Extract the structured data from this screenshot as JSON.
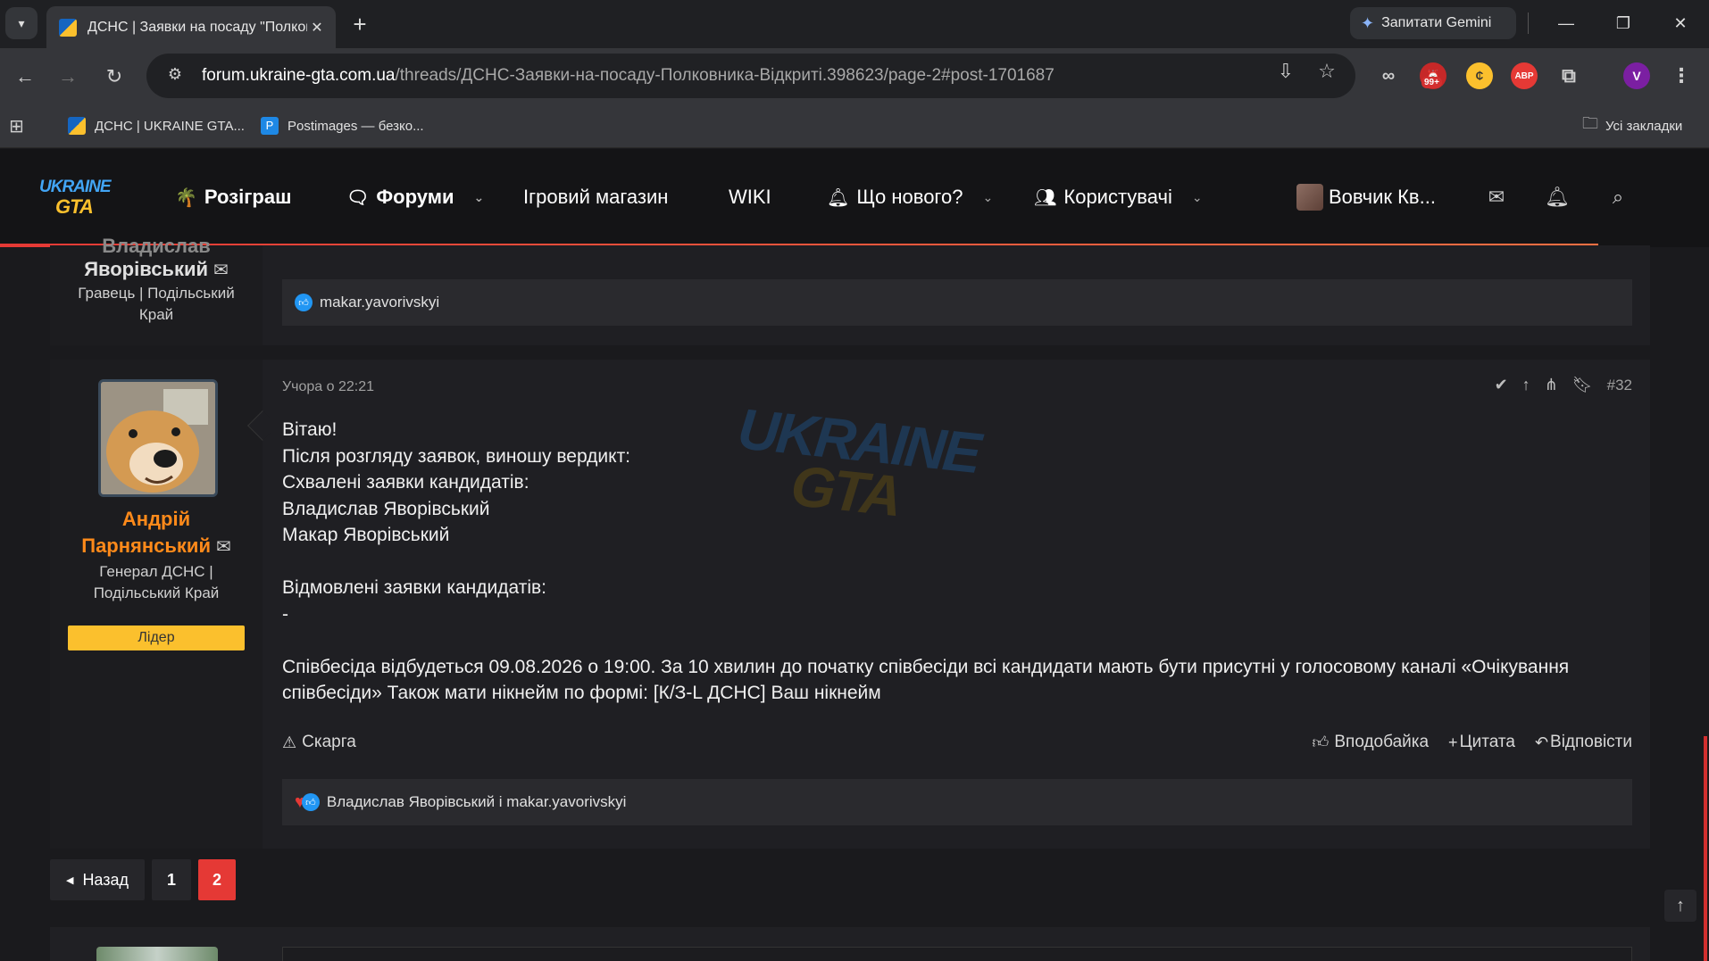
{
  "browser": {
    "tab": {
      "title": "ДСНС | Заявки на посаду \"Полковника\" Відкриті",
      "close_icon": "close-icon"
    },
    "gemini_label": "Запитати Gemini",
    "url_host": "forum.ukraine-gta.com.ua",
    "url_path": "/threads/ДСНС-Заявки-на-посаду-Полковника-Відкриті.398623/page-2#post-1701687",
    "extensions": {
      "badge_count": "99+",
      "abp_label": "ABP",
      "profile_initial": "V"
    },
    "bookmarks": [
      {
        "label": "ДСНС | UKRAINE GTA..."
      },
      {
        "label": "Postimages — безко..."
      }
    ],
    "all_bookmarks": "Усі закладки"
  },
  "site": {
    "logo": {
      "line1": "UKRAINE",
      "line2": "GTA"
    },
    "menu": {
      "giveaway": "Розіграш",
      "forums": "Форуми",
      "shop": "Ігровий магазин",
      "wiki": "WIKI",
      "whats_new": "Що нового?",
      "users": "Користувачі",
      "account": "Вовчик Кв..."
    }
  },
  "prev_post": {
    "username_partial": "Владислав",
    "username_line2": "Яворівський",
    "user_title": "Гравець | Подільський Край",
    "reactions": "makar.yavorivskyi"
  },
  "post": {
    "author_line1": "Андрій",
    "author_line2": "Парнянський",
    "user_title": "Генерал ДСНС | Подільський Край",
    "badge": "Лідер",
    "date": "Учора о 22:21",
    "number": "#32",
    "watermark": {
      "line1": "UKRAINE",
      "line2": "GTA"
    },
    "lines": [
      "Вітаю!",
      "Після розгляду заявок, виношу вердикт:",
      "Схвалені заявки кандидатів:",
      "Владислав Яворівський",
      "Макар Яворівський",
      "",
      "Відмовлені заявки кандидатів:",
      "-",
      "",
      "Співбесіда відбудеться 09.08.2026 о 19:00. За 10 хвилин до початку співбесіди всі кандидати мають бути присутні у голосовому каналі «Очікування співбесіди» Також мати нікнейм по формі: [К/З-L ДСНС] Ваш нікнейм"
    ],
    "report": "Скарга",
    "like": "Вподобайка",
    "quote": "Цитата",
    "reply": "Відповісти",
    "reactions": "Владислав Яворівський і makar.yavorivskyi"
  },
  "pagination": {
    "prev": "Назад",
    "pages": [
      "1",
      "2"
    ],
    "current": "2"
  },
  "colors": {
    "accent": "#e53935",
    "username": "#ff8a1a",
    "leader_badge": "#fbc02d"
  }
}
